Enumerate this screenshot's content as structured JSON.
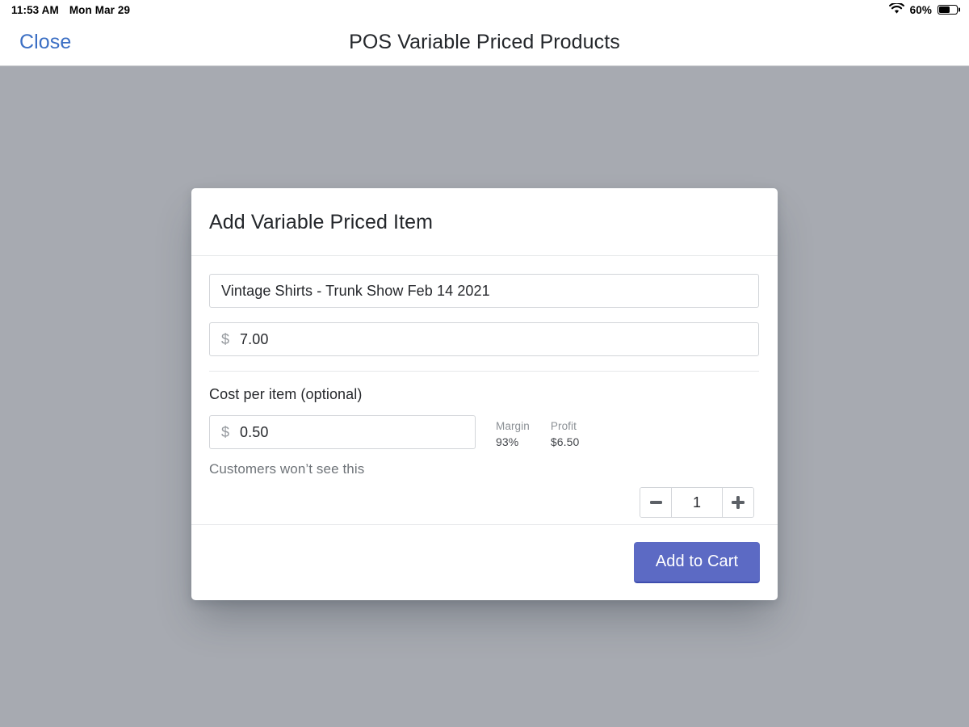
{
  "statusbar": {
    "time": "11:53 AM",
    "date": "Mon Mar 29",
    "wifi_icon": "wifi-icon",
    "battery_percent": "60%",
    "battery_level": 60
  },
  "navbar": {
    "close_label": "Close",
    "title": "POS Variable Priced Products",
    "close_color": "#3b6fc4"
  },
  "modal": {
    "title": "Add Variable Priced Item",
    "name_field": {
      "value": "Vintage Shirts - Trunk Show Feb 14 2021",
      "placeholder": "Item name"
    },
    "price_field": {
      "currency_symbol": "$",
      "value": "7.00",
      "placeholder": "0.00"
    },
    "cost_section": {
      "label": "Cost per item (optional)",
      "currency_symbol": "$",
      "value": "0.50",
      "placeholder": "0.00",
      "helper_text": "Customers won’t see this"
    },
    "metrics": [
      {
        "label": "Margin",
        "value": "93%"
      },
      {
        "label": "Profit",
        "value": "$6.50"
      }
    ],
    "quantity": {
      "decrement_icon": "minus-icon",
      "value": "1",
      "increment_icon": "plus-icon"
    },
    "footer": {
      "primary_label": "Add to Cart",
      "primary_color": "#5c6ac4"
    }
  }
}
